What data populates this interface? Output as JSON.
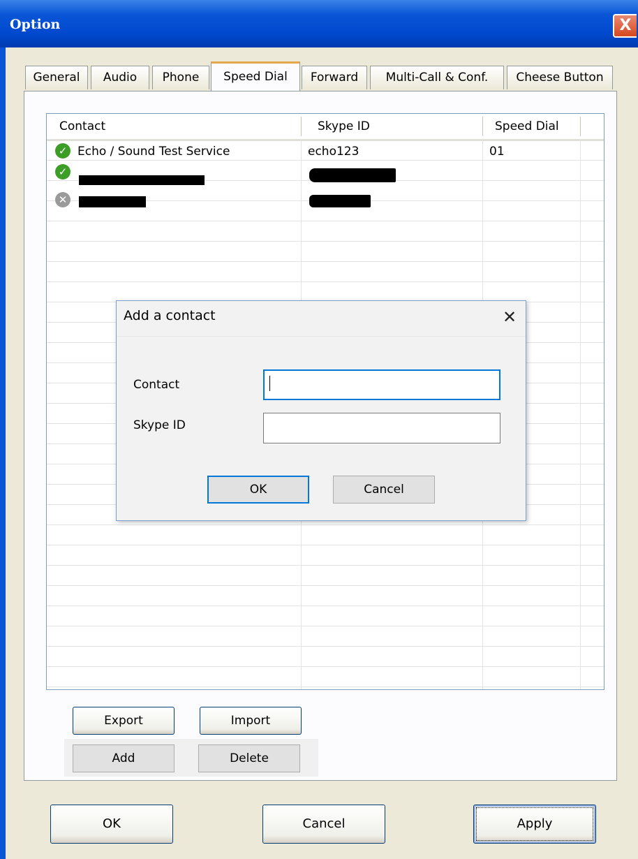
{
  "window": {
    "title": "Option",
    "close_glyph": "X"
  },
  "tabs": [
    "General",
    "Audio",
    "Phone",
    "Speed Dial",
    "Forward",
    "Multi-Call & Conf.",
    "Cheese Button"
  ],
  "active_tab": "Speed Dial",
  "list": {
    "columns": [
      "Contact",
      "Skype ID",
      "Speed Dial"
    ],
    "rows": [
      {
        "status": "online",
        "status_glyph": "✓",
        "contact": "Echo / Sound Test Service",
        "skype_id": "echo123",
        "speed_dial": "01"
      },
      {
        "status": "online",
        "status_glyph": "✓",
        "contact": "",
        "skype_id": "",
        "speed_dial": ""
      },
      {
        "status": "offline",
        "status_glyph": "✕",
        "contact": "",
        "skype_id": "",
        "speed_dial": ""
      }
    ]
  },
  "dialog": {
    "title": "Add a contact",
    "close_glyph": "✕",
    "contact_label": "Contact",
    "contact_value": "",
    "skype_id_label": "Skype ID",
    "skype_id_value": "",
    "ok": "OK",
    "cancel": "Cancel"
  },
  "list_buttons": {
    "export": "Export",
    "import": "Import",
    "add": "Add",
    "delete": "Delete"
  },
  "footer": {
    "ok": "OK",
    "cancel": "Cancel",
    "apply": "Apply"
  },
  "colors": {
    "titlebar": "#0a55d6",
    "active_tab_accent": "#e6a64a",
    "status_online": "#3d9e27",
    "status_offline": "#9a9a9a",
    "dialog_focus": "#0078d7"
  }
}
